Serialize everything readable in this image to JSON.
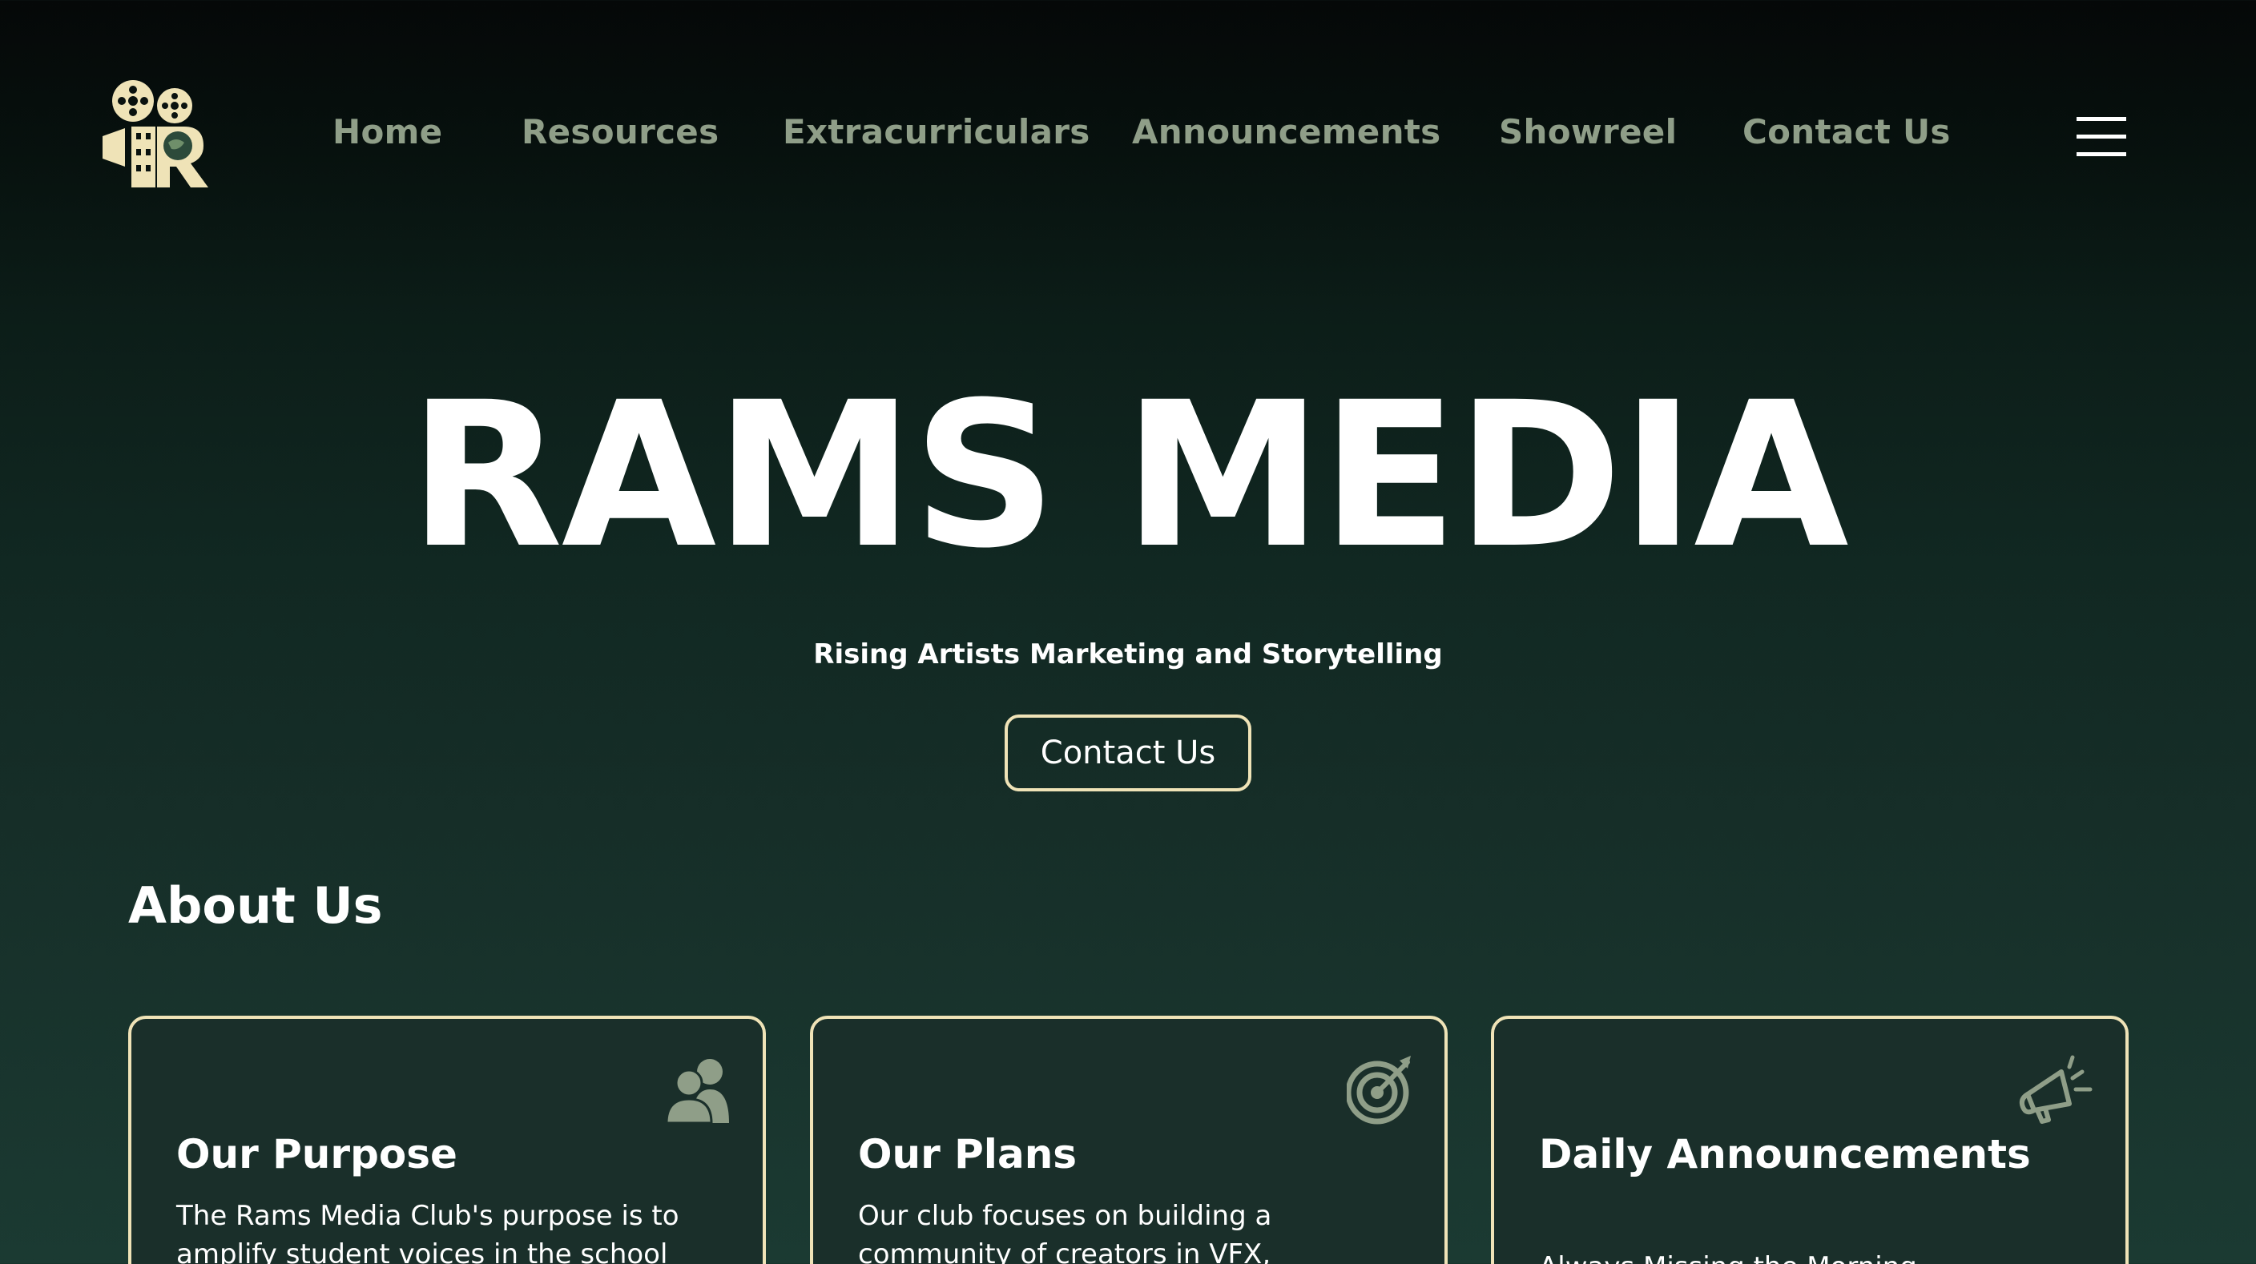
{
  "nav": {
    "logo_name": "film-camera-logo",
    "links": [
      "Home",
      "Resources",
      "Extracurriculars",
      "Announcements",
      "Showreel",
      "Contact Us"
    ],
    "menu_icon": "hamburger-icon"
  },
  "hero": {
    "title": "RAMS MEDIA",
    "subtitle": "Rising Artists Marketing and Storytelling",
    "button_label": "Contact Us"
  },
  "about": {
    "heading": "About Us",
    "cards": [
      {
        "icon": "users-icon",
        "title": "Our Purpose",
        "text": "The Rams Media Club's purpose is to amplify student voices in the school"
      },
      {
        "icon": "target-icon",
        "title": "Our Plans",
        "text": "Our club focuses on building a community of creators in VFX,"
      },
      {
        "icon": "megaphone-icon",
        "title": "Daily Announcements",
        "text": "Always Missing the Morning"
      }
    ]
  },
  "colors": {
    "nav_link": "#8f9e88",
    "accent_border": "#efe3b7",
    "logo_cream": "#efe3b7",
    "icon_sage": "#8f9e88",
    "background_top": "#050808",
    "background_bottom": "#1b3a32"
  }
}
